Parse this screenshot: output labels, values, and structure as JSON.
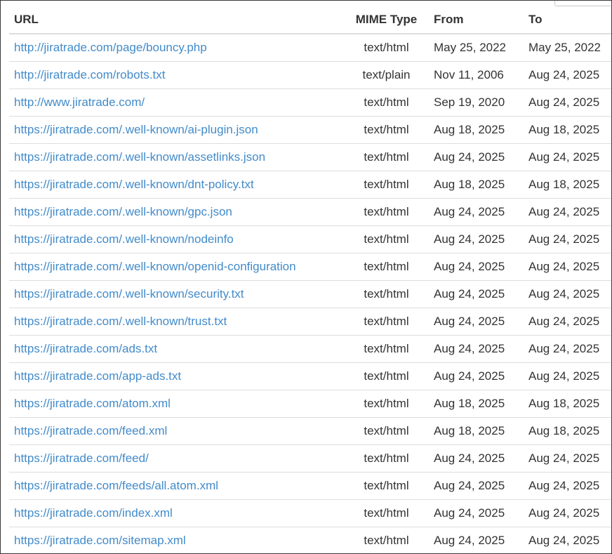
{
  "table": {
    "headers": {
      "url": "URL",
      "mime": "MIME Type",
      "from": "From",
      "to": "To"
    },
    "link_color": "#428bca",
    "rows": [
      {
        "url": "http://jiratrade.com/page/bouncy.php",
        "mime": "text/html",
        "from": "May 25, 2022",
        "to": "May 25, 2022"
      },
      {
        "url": "http://jiratrade.com/robots.txt",
        "mime": "text/plain",
        "from": "Nov 11, 2006",
        "to": "Aug 24, 2025"
      },
      {
        "url": "http://www.jiratrade.com/",
        "mime": "text/html",
        "from": "Sep 19, 2020",
        "to": "Aug 24, 2025"
      },
      {
        "url": "https://jiratrade.com/.well-known/ai-plugin.json",
        "mime": "text/html",
        "from": "Aug 18, 2025",
        "to": "Aug 18, 2025"
      },
      {
        "url": "https://jiratrade.com/.well-known/assetlinks.json",
        "mime": "text/html",
        "from": "Aug 24, 2025",
        "to": "Aug 24, 2025"
      },
      {
        "url": "https://jiratrade.com/.well-known/dnt-policy.txt",
        "mime": "text/html",
        "from": "Aug 18, 2025",
        "to": "Aug 18, 2025"
      },
      {
        "url": "https://jiratrade.com/.well-known/gpc.json",
        "mime": "text/html",
        "from": "Aug 24, 2025",
        "to": "Aug 24, 2025"
      },
      {
        "url": "https://jiratrade.com/.well-known/nodeinfo",
        "mime": "text/html",
        "from": "Aug 24, 2025",
        "to": "Aug 24, 2025"
      },
      {
        "url": "https://jiratrade.com/.well-known/openid-configuration",
        "mime": "text/html",
        "from": "Aug 24, 2025",
        "to": "Aug 24, 2025"
      },
      {
        "url": "https://jiratrade.com/.well-known/security.txt",
        "mime": "text/html",
        "from": "Aug 24, 2025",
        "to": "Aug 24, 2025"
      },
      {
        "url": "https://jiratrade.com/.well-known/trust.txt",
        "mime": "text/html",
        "from": "Aug 24, 2025",
        "to": "Aug 24, 2025"
      },
      {
        "url": "https://jiratrade.com/ads.txt",
        "mime": "text/html",
        "from": "Aug 24, 2025",
        "to": "Aug 24, 2025"
      },
      {
        "url": "https://jiratrade.com/app-ads.txt",
        "mime": "text/html",
        "from": "Aug 24, 2025",
        "to": "Aug 24, 2025"
      },
      {
        "url": "https://jiratrade.com/atom.xml",
        "mime": "text/html",
        "from": "Aug 18, 2025",
        "to": "Aug 18, 2025"
      },
      {
        "url": "https://jiratrade.com/feed.xml",
        "mime": "text/html",
        "from": "Aug 18, 2025",
        "to": "Aug 18, 2025"
      },
      {
        "url": "https://jiratrade.com/feed/",
        "mime": "text/html",
        "from": "Aug 24, 2025",
        "to": "Aug 24, 2025"
      },
      {
        "url": "https://jiratrade.com/feeds/all.atom.xml",
        "mime": "text/html",
        "from": "Aug 24, 2025",
        "to": "Aug 24, 2025"
      },
      {
        "url": "https://jiratrade.com/index.xml",
        "mime": "text/html",
        "from": "Aug 24, 2025",
        "to": "Aug 24, 2025"
      },
      {
        "url": "https://jiratrade.com/sitemap.xml",
        "mime": "text/html",
        "from": "Aug 24, 2025",
        "to": "Aug 24, 2025"
      }
    ]
  }
}
